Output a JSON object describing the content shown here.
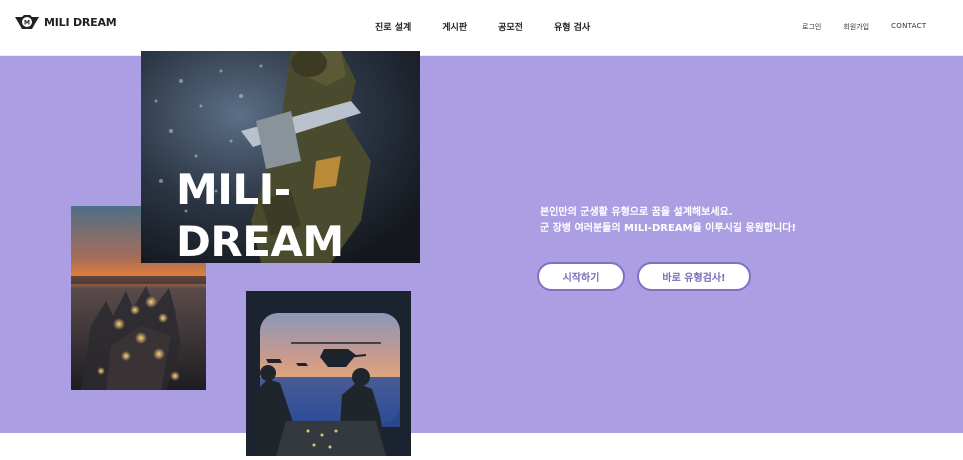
{
  "header": {
    "logo": {
      "text": "MILI DREAM",
      "icon": "mili-dream-emblem-icon"
    },
    "nav": [
      {
        "label": "진로 설계"
      },
      {
        "label": "게시판"
      },
      {
        "label": "공모전"
      },
      {
        "label": "유형 검사"
      }
    ],
    "auth": [
      {
        "label": "로그인"
      },
      {
        "label": "회원가입"
      },
      {
        "label": "CONTACT"
      }
    ]
  },
  "hero": {
    "background": "#ac9ee2",
    "title_line1": "MILI-",
    "title_line2": "DREAM",
    "desc_line1": "본인만의 군생활 유형으로 꿈을 설계해보세요.",
    "desc_line2": "군 장병 여러분들의 MILI-DREAM을 이루시길 응원합니다!",
    "buttons": {
      "start": "시작하기",
      "test": "바로 유형검사!"
    },
    "accent": "#8270c4"
  }
}
